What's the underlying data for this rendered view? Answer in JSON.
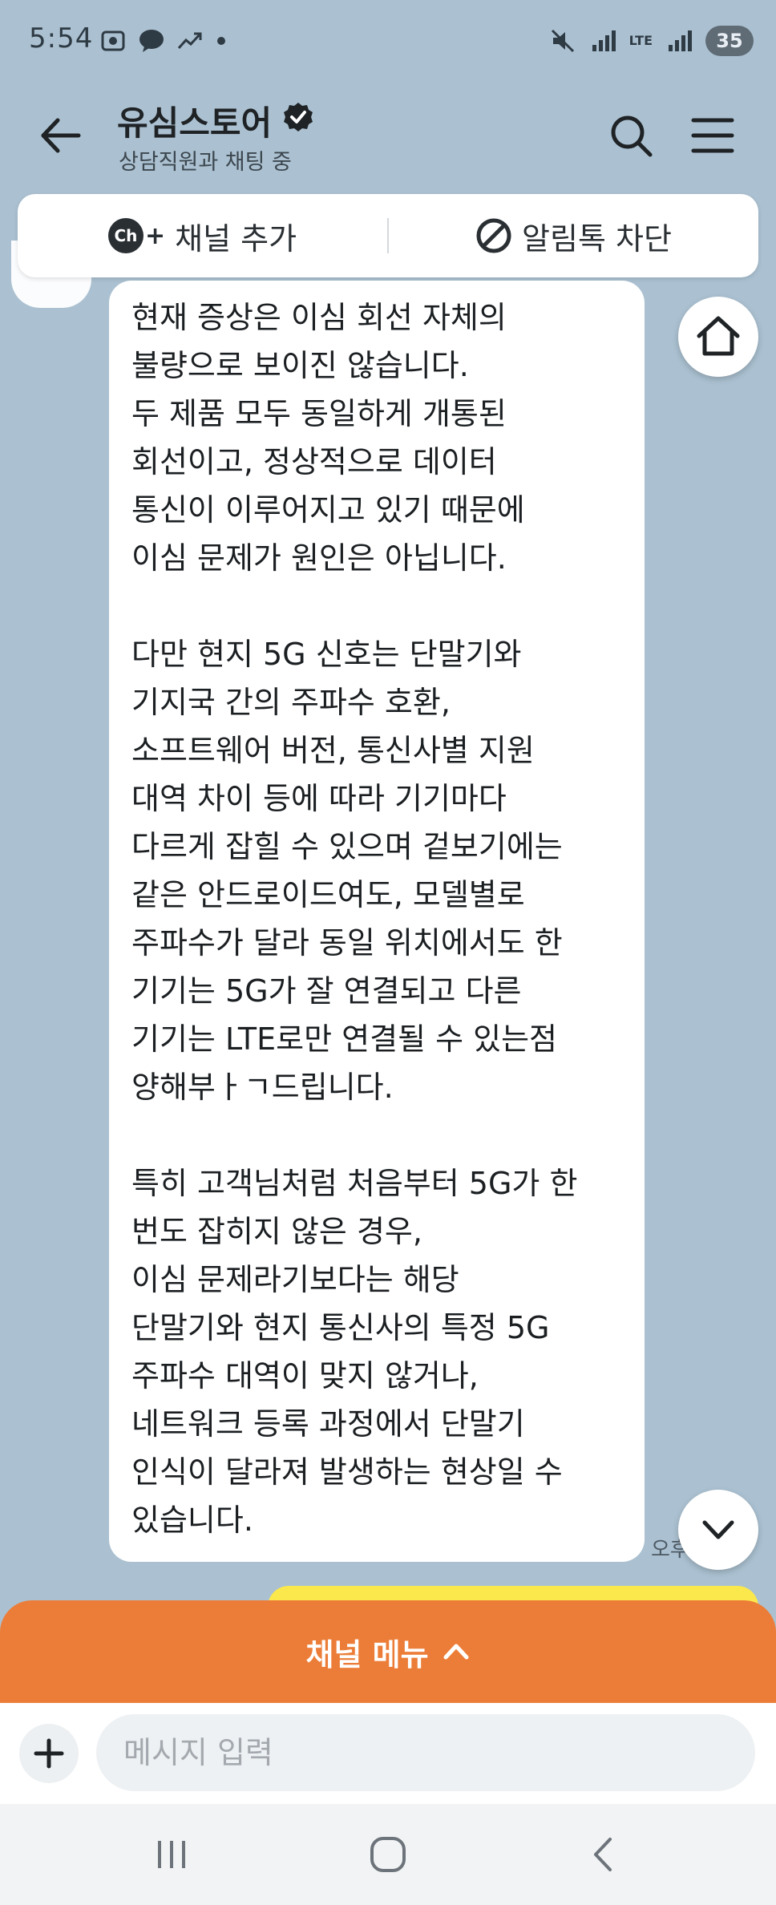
{
  "status_bar": {
    "time": "5:54",
    "battery": "35",
    "network": "LTE"
  },
  "header": {
    "channel_name": "유심스토어",
    "subtitle": "상담직원과 채팅 중"
  },
  "action_bar": {
    "add_channel_label": "채널 추가",
    "block_label": "알림톡 차단",
    "ch_badge": "Ch"
  },
  "message": {
    "lines": [
      "현재 증상은 이심 회선 자체의",
      "불량으로 보이진 않습니다.",
      "두 제품 모두 동일하게 개통된",
      "회선이고, 정상적으로 데이터",
      "통신이 이루어지고 있기 때문에",
      "이심 문제가 원인은 아닙니다.",
      "",
      "다만 현지 5G 신호는 단말기와",
      "기지국 간의 주파수 호환,",
      "소프트웨어 버전, 통신사별 지원",
      "대역 차이 등에 따라 기기마다",
      "다르게 잡힐 수 있으며 겉보기에는",
      "같은 안드로이드여도, 모델별로",
      "주파수가 달라 동일 위치에서도 한",
      "기기는 5G가 잘 연결되고 다른",
      "기기는 LTE로만 연결될 수 있는점",
      "양해부ㅏㄱ드립니다.",
      "",
      "특히 고객님처럼 처음부터 5G가 한",
      "번도 잡히지 않은 경우,",
      "이심 문제라기보다는 해당",
      "단말기와 현지 통신사의 특정 5G",
      "주파수 대역이 맞지 않거나,",
      "네트워크 등록 과정에서 단말기",
      "인식이 달라져 발생하는 현상일 수",
      "있습니다."
    ],
    "time": "오후"
  },
  "channel_menu": {
    "label": "채널 메뉴"
  },
  "input": {
    "placeholder": "메시지 입력"
  },
  "colors": {
    "chat_background": "#abc1d1",
    "channel_menu": "#ec7d38",
    "my_bubble": "#fae84c"
  }
}
